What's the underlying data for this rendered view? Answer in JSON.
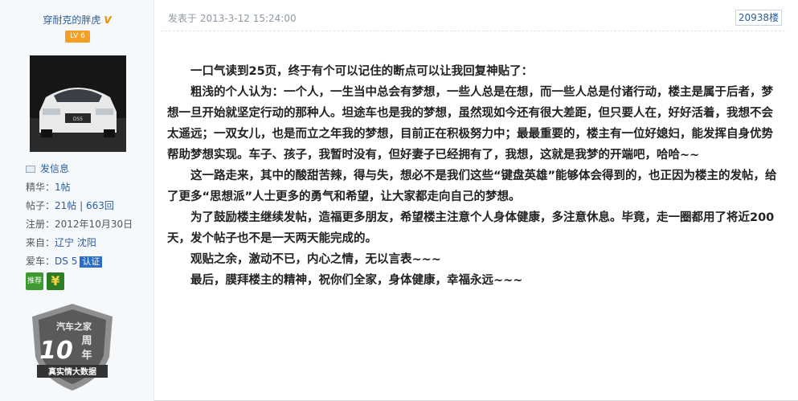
{
  "user": {
    "name": "穿耐克的胖虎",
    "vip_mark": "V",
    "level": "LV 6",
    "send_message": "发信息",
    "essence_label": "精华：",
    "essence_value": "1帖",
    "posts_label": "帖子：",
    "posts_threads": "21帖",
    "posts_sep": " | ",
    "posts_replies": "663回",
    "registered_label": "注册：",
    "registered_value": "2012年10月30日",
    "from_label": "来自：",
    "from_value": "辽宁 沈阳",
    "car_label": "爱车：",
    "car_value": "DS 5",
    "car_cert": "认证",
    "medal_recommend": "推荐",
    "medal_money": "¥",
    "anniversary_badge_text": "汽车之家10周年 真实情大数据",
    "anniversary_top": "汽车之家",
    "anniversary_mid": "周",
    "anniversary_mid2": "年",
    "anniversary_num": "10",
    "anniversary_bottom": "真实情大数据",
    "avatar_plate": "DS5"
  },
  "post": {
    "time": "发表于 2013-3-12 15:24:00",
    "floor": "20938楼",
    "paragraphs": [
      "一口气读到25页，终于有个可以记住的断点可以让我回复神贴了：",
      "粗浅的个人认为：一个人，一生当中总会有梦想，一些人总是在想，而一些人总是付诸行动，楼主是属于后者，梦想一旦开始就坚定行动的那种人。坦途车也是我的梦想，虽然现如今还有很大差距，但只要人在，好好活着，我想不会太遥远；一双女儿，也是而立之年我的梦想，目前正在积极努力中；最最重要的，楼主有一位好媳妇，能发挥自身优势帮助梦想实现。车子、孩子，我暂时没有，但好妻子已经拥有了，我想，这就是我梦的开端吧，哈哈~~",
      "这一路走来，其中的酸甜苦辣，得与失，想必不是我们这些“键盘英雄”能够体会得到的，也正因为楼主的发帖，给了更多“思想派”人士更多的勇气和希望，让大家都走向自己的梦想。",
      "为了鼓励楼主继续发帖，造福更多朋友，希望楼主注意个人身体健康，多注意休息。毕竟，走一圈都用了将近200天，发个帖子也不是一天两天能完成的。",
      "观贴之余，激动不已，内心之情，无以言表~~~",
      "最后，膜拜楼主的精神，祝你们全家，身体健康，幸福永远~~~"
    ]
  },
  "colors": {
    "link": "#2b5d9b",
    "level_badge": "#f6a023",
    "cert_badge": "#2b6cc4",
    "sidebar_bg": "#f6f9fc"
  }
}
